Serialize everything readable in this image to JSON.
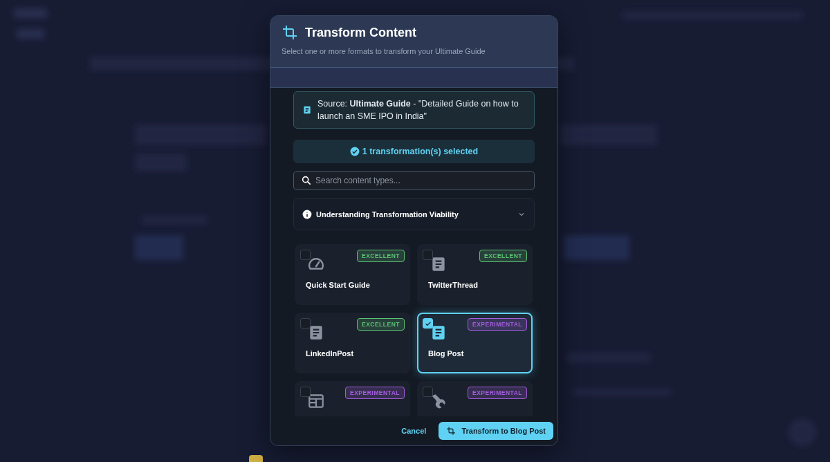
{
  "dialog": {
    "title": "Transform Content",
    "subtitle": "Select one or more formats to transform your Ultimate Guide"
  },
  "source": {
    "text": "Source: **Ultimate Guide** - \"Detailed Guide on how to launch an SME IPO in India\""
  },
  "selection_summary": "1 transformation(s) selected",
  "search": {
    "placeholder": "Search content types..."
  },
  "accordion": {
    "title": "Understanding Transformation Viability",
    "expanded": false
  },
  "formats": [
    {
      "kind": "gauge",
      "name": "Quick Start Guide",
      "badge": {
        "label": "EXCELLENT",
        "color": "#5cc274"
      },
      "selected": false
    },
    {
      "kind": "document",
      "name": "TwitterThread",
      "badge": {
        "label": "EXCELLENT",
        "color": "#5cc274"
      },
      "selected": false
    },
    {
      "kind": "document",
      "name": "LinkedInPost",
      "badge": {
        "label": "EXCELLENT",
        "color": "#5cc274"
      },
      "selected": false
    },
    {
      "kind": "document",
      "name": "Blog Post",
      "badge": {
        "label": "EXPERIMENTAL",
        "color": "#a45ee0"
      },
      "selected": true
    },
    {
      "kind": "newspaper",
      "badge": {
        "label": "EXPERIMENTAL",
        "color": "#a45ee0"
      },
      "selected": false
    },
    {
      "kind": "wrench",
      "badge": {
        "label": "EXPERIMENTAL",
        "color": "#a45ee0"
      },
      "selected": false
    }
  ],
  "buttons": {
    "cancel": "Cancel",
    "confirm": "Transform to Blog Post"
  }
}
